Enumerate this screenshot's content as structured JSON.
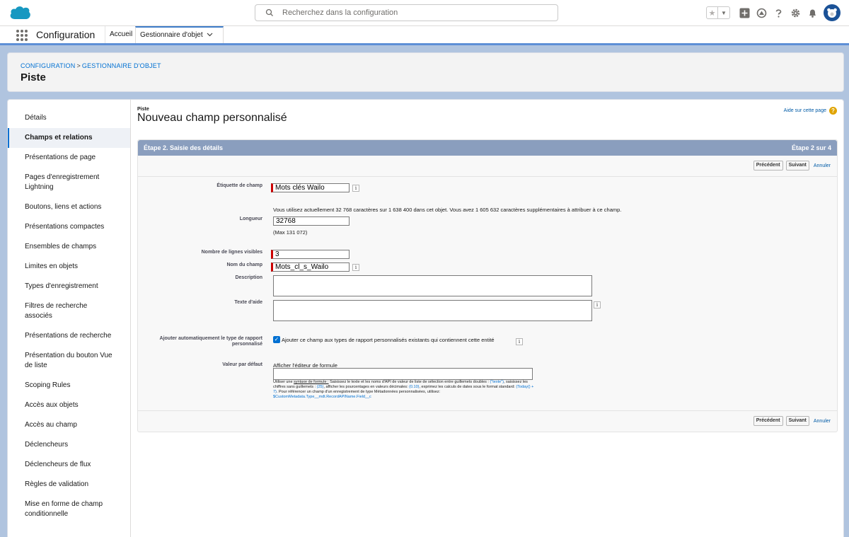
{
  "header": {
    "search_placeholder": "Recherchez dans la configuration",
    "icons": [
      "cloud-logo-icon",
      "search-icon",
      "star-icon",
      "chevron-down-icon",
      "add-icon",
      "trailhead-icon",
      "help-icon",
      "gear-icon",
      "bell-icon",
      "avatar"
    ]
  },
  "nav": {
    "app_name": "Configuration",
    "home": "Accueil",
    "tab": "Gestionnaire d'objet"
  },
  "breadcrumb": {
    "root": "CONFIGURATION",
    "separator": ">",
    "current": "GESTIONNAIRE D'OBJET"
  },
  "page": {
    "title": "Piste"
  },
  "sidebar": {
    "items": [
      {
        "label": "Détails"
      },
      {
        "label": "Champs et relations",
        "active": true
      },
      {
        "label": "Présentations de page"
      },
      {
        "label": "Pages d'enregistrement Lightning"
      },
      {
        "label": "Boutons, liens et actions"
      },
      {
        "label": "Présentations compactes"
      },
      {
        "label": "Ensembles de champs"
      },
      {
        "label": "Limites en objets"
      },
      {
        "label": "Types d'enregistrement"
      },
      {
        "label": "Filtres de recherche associés"
      },
      {
        "label": "Présentations de recherche"
      },
      {
        "label": "Présentation du bouton Vue de liste"
      },
      {
        "label": "Scoping Rules"
      },
      {
        "label": "Accès aux objets"
      },
      {
        "label": "Accès au champ"
      },
      {
        "label": "Déclencheurs"
      },
      {
        "label": "Déclencheurs de flux"
      },
      {
        "label": "Règles de validation"
      },
      {
        "label": "Mise en forme de champ conditionnelle"
      }
    ]
  },
  "form": {
    "object_label": "Piste",
    "title": "Nouveau champ personnalisé",
    "help_link": "Aide sur cette page",
    "step_label": "Étape 2. Saisie des détails",
    "step_count": "Étape 2 sur 4",
    "buttons": {
      "previous": "Précédent",
      "next": "Suivant",
      "cancel": "Annuler"
    },
    "fields": {
      "field_label": {
        "label": "Étiquette de champ",
        "value": "Mots clés Wailo"
      },
      "usage_note": "Vous utilisez actuellement 32 768 caractères sur 1 638 400 dans cet objet. Vous avez 1 605 632 caractères supplémentaires à attribuer à ce champ.",
      "length": {
        "label": "Longueur",
        "value": "32768",
        "max": "(Max 131 072)"
      },
      "visible_lines": {
        "label": "Nombre de lignes visibles",
        "value": "3"
      },
      "field_name": {
        "label": "Nom du champ",
        "value": "Mots_cl_s_Wailo"
      },
      "description": {
        "label": "Description",
        "value": ""
      },
      "help_text": {
        "label": "Texte d'aide",
        "value": ""
      },
      "report_type": {
        "label": "Ajouter automatiquement le type de rapport personnalisé",
        "checkbox_label": "Ajouter ce champ aux types de rapport personnalisés existants qui contiennent cette entité",
        "checked": true
      },
      "default_value": {
        "label": "Valeur par défaut",
        "formula_link": "Afficher l'éditeur de formule",
        "value": "",
        "help_1": "Utiliser une ",
        "help_link": "syntaxe de formule :",
        "help_2": " Saisissez le texte et les noms d'API de valeur de liste de sélection entre guillemets doubles : ",
        "help_ex1": "(\"texte\")",
        "help_3": ", saisissez les chiffres sans guillemets : ",
        "help_ex2": "(25)",
        "help_4": ", afficher les pourcentages en valeurs décimales: ",
        "help_ex3": "(0.10)",
        "help_5": ", exprimez les calculs de dates sous le format standard: ",
        "help_ex4": "(Today() + 7)",
        "help_6": ". Pour référencer un champ d'un enregistrement de type Métadonnées personnalisées, utilisez: ",
        "help_ex5": "$CustomMetadata.Type__mdt.RecordAPIName.Field__c"
      }
    }
  }
}
